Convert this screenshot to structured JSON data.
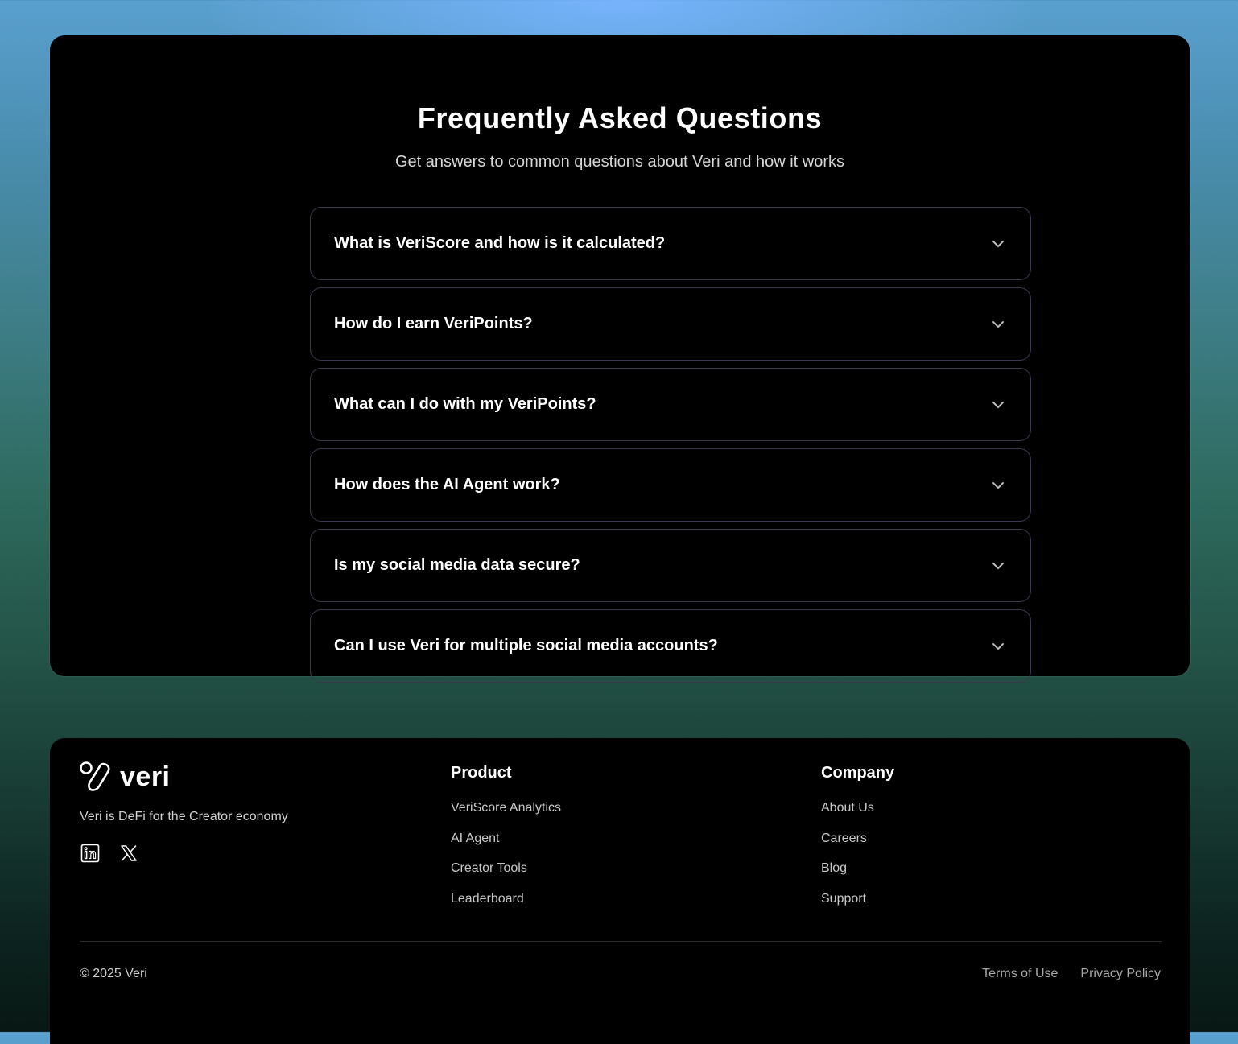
{
  "faq": {
    "title": "Frequently Asked Questions",
    "subtitle": "Get answers to common questions about Veri and how it works",
    "items": [
      {
        "question": "What is VeriScore and how is it calculated?"
      },
      {
        "question": "How do I earn VeriPoints?"
      },
      {
        "question": "What can I do with my VeriPoints?"
      },
      {
        "question": "How does the AI Agent work?"
      },
      {
        "question": "Is my social media data secure?"
      },
      {
        "question": "Can I use Veri for multiple social media accounts?"
      }
    ]
  },
  "footer": {
    "brand": "veri",
    "tagline": "Veri is DeFi for the Creator economy",
    "socials": [
      "linkedin-icon",
      "x-icon"
    ],
    "product": {
      "heading": "Product",
      "links": [
        "VeriScore Analytics",
        "AI Agent",
        "Creator Tools",
        "Leaderboard"
      ]
    },
    "company": {
      "heading": "Company",
      "links": [
        "About Us",
        "Careers",
        "Blog",
        "Support"
      ]
    },
    "copyright": "© 2025 Veri",
    "legal": {
      "terms": "Terms of Use",
      "privacy": "Privacy Policy"
    }
  },
  "colors": {
    "card_bg": "#000000",
    "border": "#3a3a4e",
    "text": "#ffffff",
    "muted": "#c8c8c8"
  }
}
